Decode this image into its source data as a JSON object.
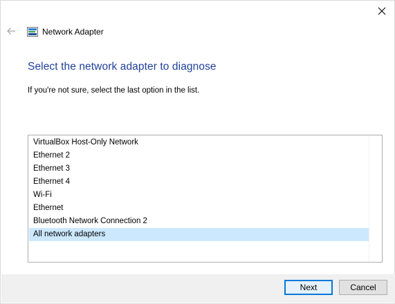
{
  "window": {
    "title": "Network Adapter"
  },
  "page": {
    "heading": "Select the network adapter to diagnose",
    "instruction": "If you're not sure, select the last option in the list."
  },
  "adapters": {
    "items": [
      "VirtualBox Host-Only Network",
      "Ethernet 2",
      "Ethernet 3",
      "Ethernet 4",
      "Wi-Fi",
      "Ethernet",
      "Bluetooth Network Connection 2",
      "All network adapters"
    ],
    "selected_index": 7
  },
  "buttons": {
    "next": "Next",
    "cancel": "Cancel"
  },
  "colors": {
    "heading": "#1f3f99",
    "selection": "#cce8ff",
    "footer": "#f0f0f0",
    "accent": "#0078d7"
  },
  "icons": {
    "close": "close-icon",
    "back": "back-arrow-icon",
    "title": "network-adapter-icon"
  }
}
